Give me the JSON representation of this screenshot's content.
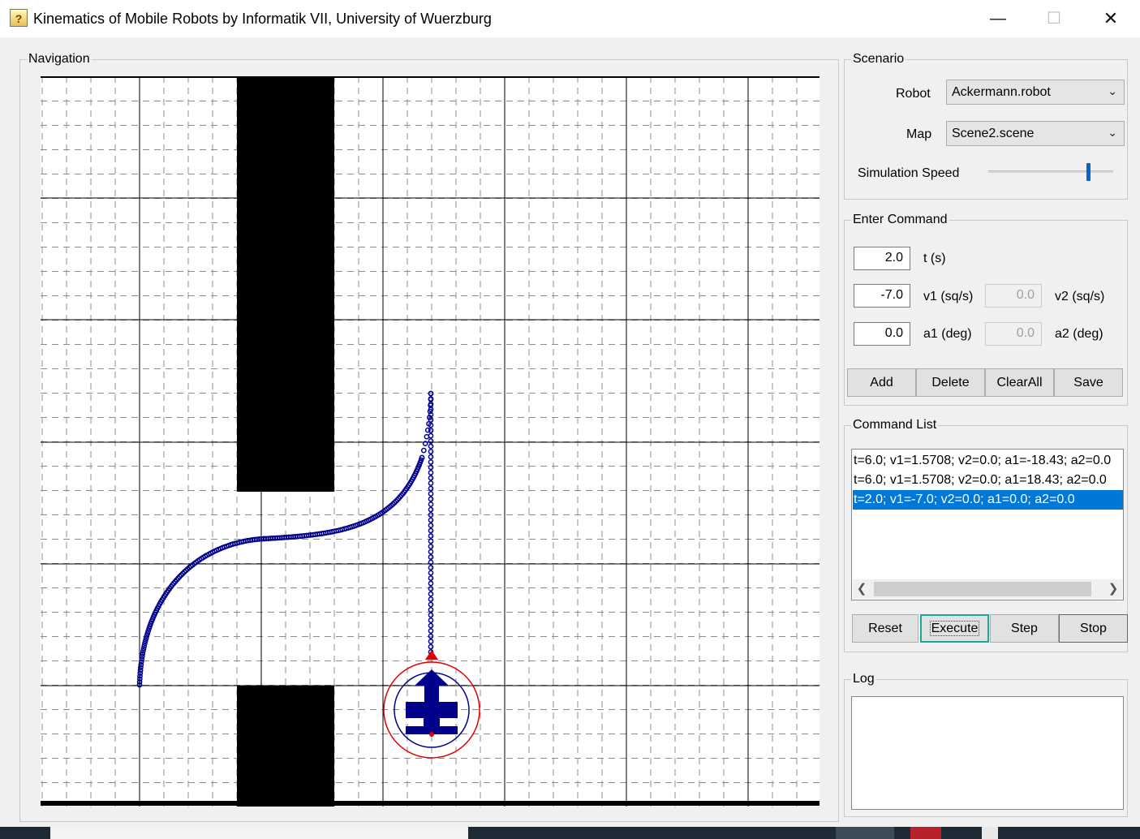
{
  "window": {
    "title": "Kinematics of Mobile Robots by Informatik VII, University of Wuerzburg",
    "app_icon": "app-icon",
    "controls": {
      "minimize": "—",
      "maximize": "☐",
      "close": "✕"
    }
  },
  "navigation": {
    "label": "Navigation",
    "robot_path_color": "#00008b",
    "robot_body_color": "#00008b",
    "robot_ring_color": "#e00000",
    "obstacle_color": "#000000"
  },
  "scenario": {
    "label": "Scenario",
    "robot_label": "Robot",
    "robot_value": "Ackermann.robot",
    "map_label": "Map",
    "map_value": "Scene2.scene",
    "speed_label": "Simulation Speed",
    "speed_level": 0.82
  },
  "enter_command": {
    "label": "Enter Command",
    "t_value": "2.0",
    "t_label": "t (s)",
    "v1_value": "-7.0",
    "v1_label": "v1 (sq/s)",
    "v2_value": "0.0",
    "v2_label": "v2 (sq/s)",
    "a1_value": "0.0",
    "a1_label": "a1 (deg)",
    "a2_value": "0.0",
    "a2_label": "a2 (deg)",
    "buttons": {
      "add": "Add",
      "delete": "Delete",
      "clear_all": "ClearAll",
      "save": "Save"
    }
  },
  "command_list": {
    "label": "Command List",
    "items": [
      "t=6.0; v1=1.5708; v2=0.0; a1=-18.43; a2=0.0",
      "t=6.0; v1=1.5708; v2=0.0; a1=18.43; a2=0.0",
      "t=2.0; v1=-7.0; v2=0.0; a1=0.0; a2=0.0"
    ],
    "selected_index": 2,
    "buttons": {
      "reset": "Reset",
      "execute": "Execute",
      "step": "Step",
      "stop": "Stop"
    },
    "accent_colors": {
      "selection": "#0078d7",
      "execute_focus": "#1aa898",
      "stop_border": "#e03030"
    }
  },
  "log": {
    "label": "Log",
    "content": ""
  }
}
